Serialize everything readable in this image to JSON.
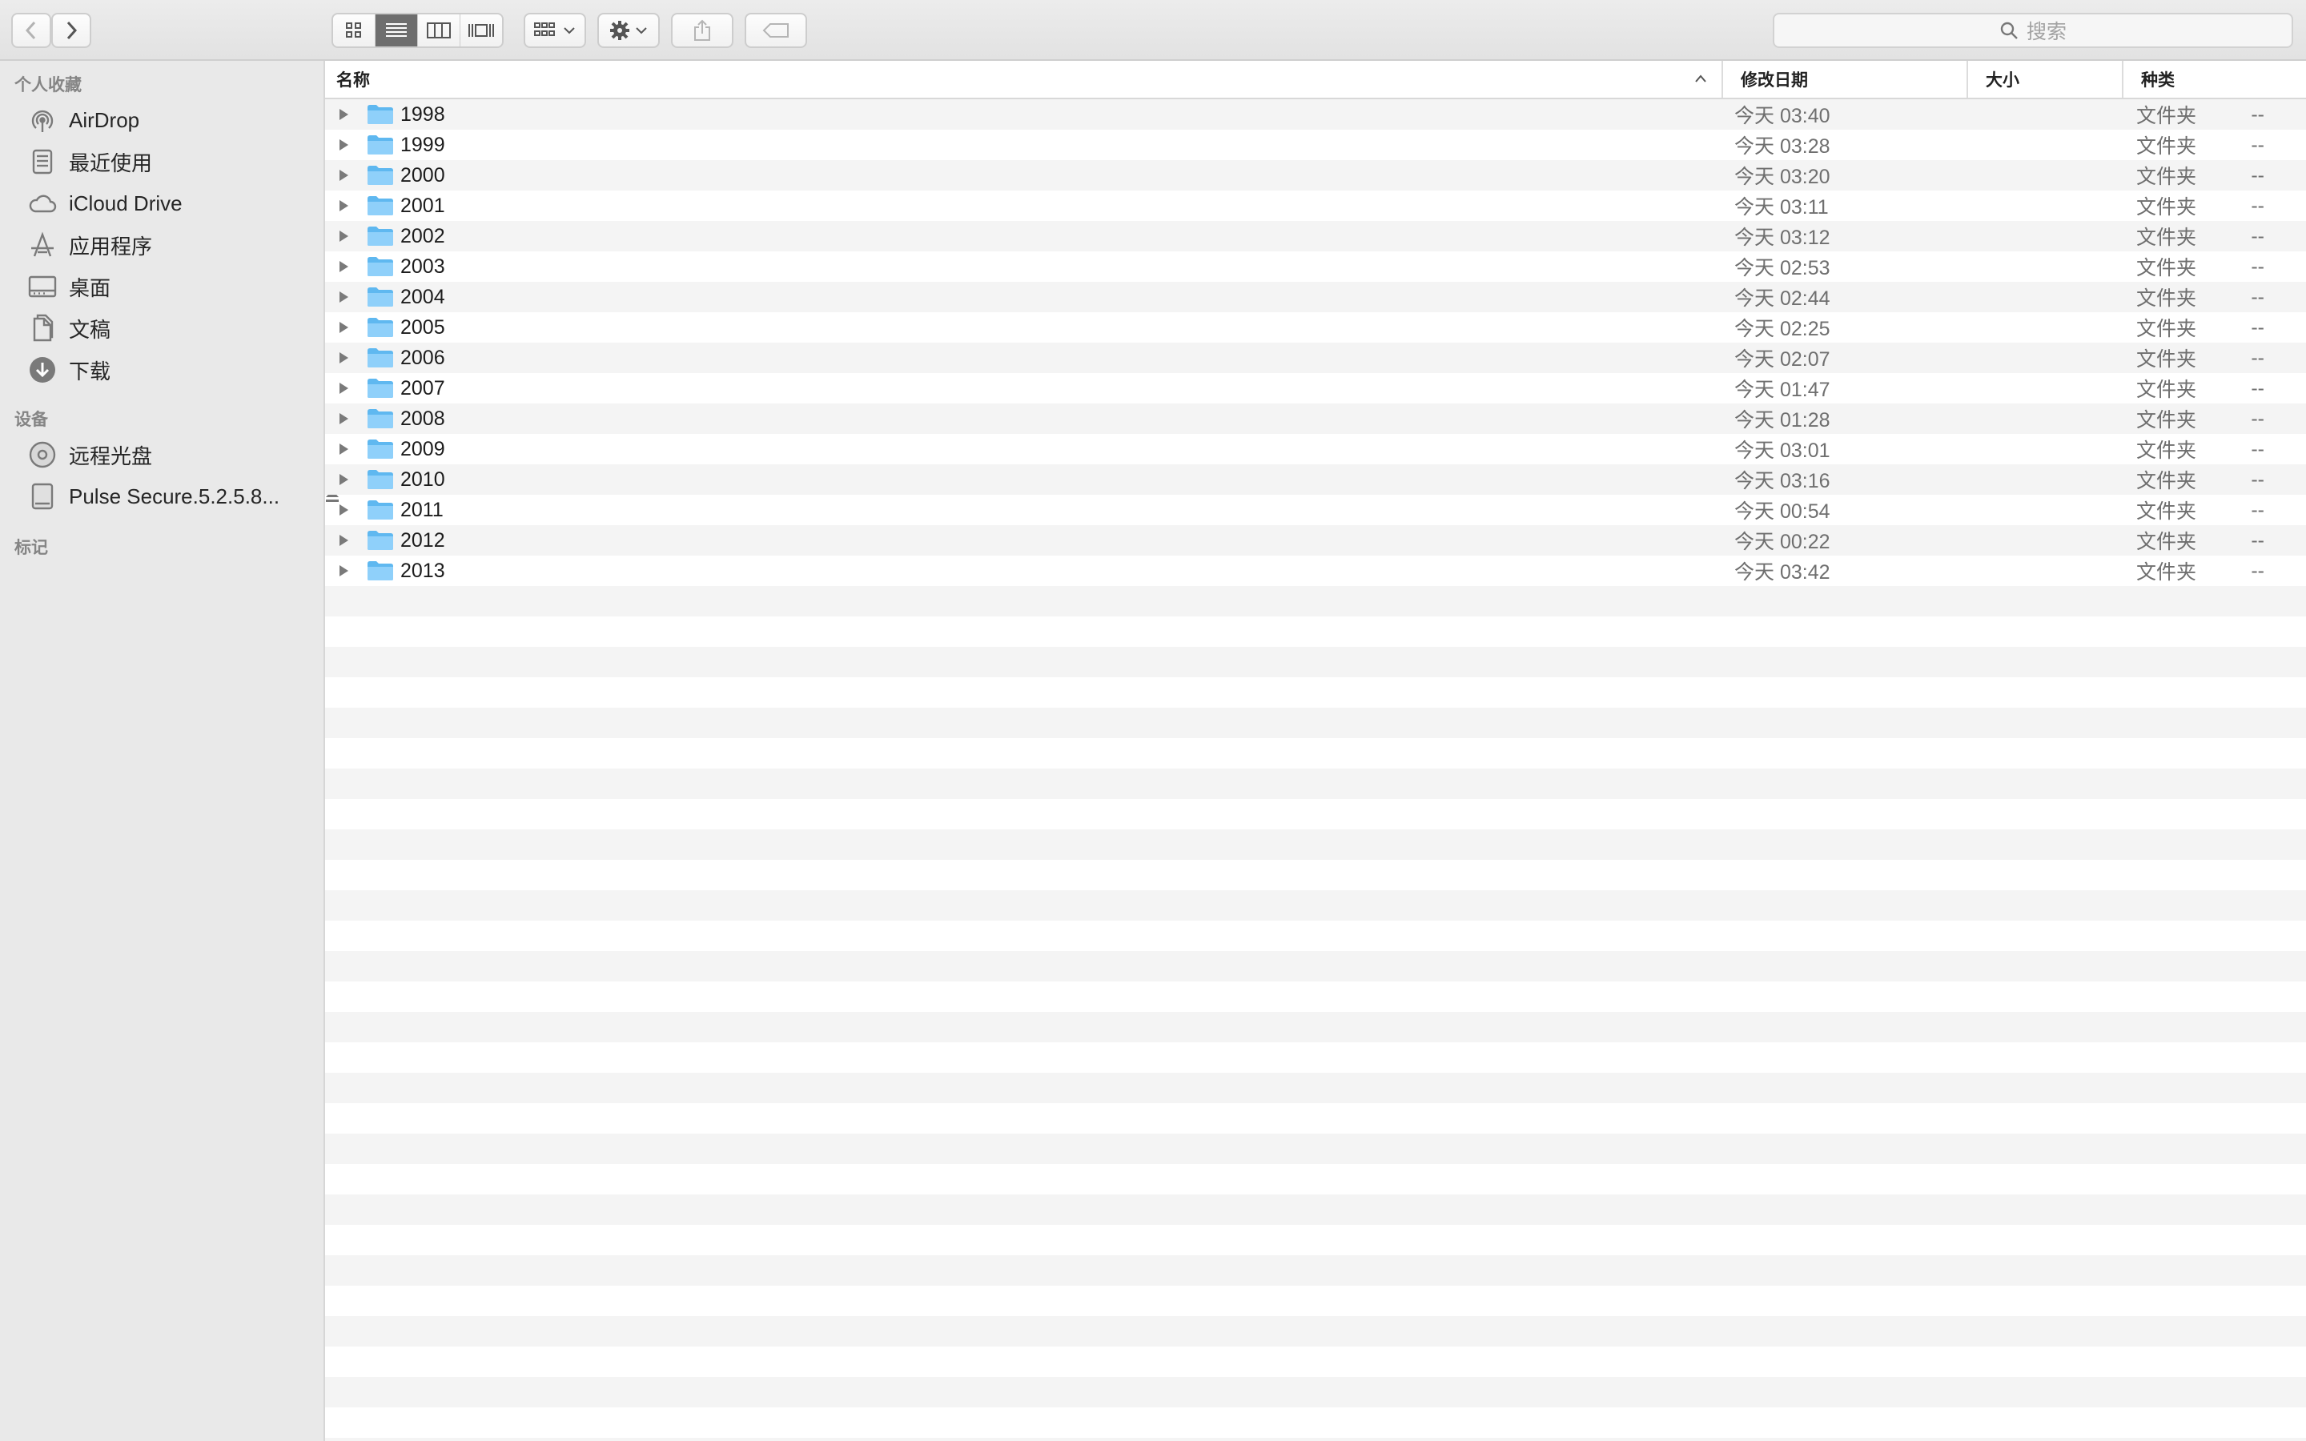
{
  "toolbar": {
    "search_placeholder": "搜索",
    "icons": [
      "chevron-left-icon",
      "chevron-right-icon",
      "icon-view-icon",
      "list-view-icon",
      "column-view-icon",
      "gallery-view-icon",
      "group-icon",
      "gear-icon",
      "share-icon",
      "tag-icon",
      "search-icon"
    ]
  },
  "sidebar": {
    "favorites_title": "个人收藏",
    "favorites": [
      {
        "label": "AirDrop",
        "icon": "airdrop-icon"
      },
      {
        "label": "最近使用",
        "icon": "recents-icon"
      },
      {
        "label": "iCloud Drive",
        "icon": "cloud-icon"
      },
      {
        "label": "应用程序",
        "icon": "applications-icon"
      },
      {
        "label": "桌面",
        "icon": "desktop-icon"
      },
      {
        "label": "文稿",
        "icon": "documents-icon"
      },
      {
        "label": "下载",
        "icon": "downloads-icon"
      }
    ],
    "devices_title": "设备",
    "devices": [
      {
        "label": "远程光盘",
        "icon": "disc-icon"
      },
      {
        "label": "Pulse Secure.5.2.5.8...",
        "icon": "drive-icon"
      }
    ],
    "tags_title": "标记"
  },
  "columns": {
    "name": "名称",
    "date": "修改日期",
    "size": "大小",
    "kind": "种类"
  },
  "files": [
    {
      "name": "1998",
      "date": "今天 03:40",
      "size": "--",
      "kind": "文件夹"
    },
    {
      "name": "1999",
      "date": "今天 03:28",
      "size": "--",
      "kind": "文件夹"
    },
    {
      "name": "2000",
      "date": "今天 03:20",
      "size": "--",
      "kind": "文件夹"
    },
    {
      "name": "2001",
      "date": "今天 03:11",
      "size": "--",
      "kind": "文件夹"
    },
    {
      "name": "2002",
      "date": "今天 03:12",
      "size": "--",
      "kind": "文件夹"
    },
    {
      "name": "2003",
      "date": "今天 02:53",
      "size": "--",
      "kind": "文件夹"
    },
    {
      "name": "2004",
      "date": "今天 02:44",
      "size": "--",
      "kind": "文件夹"
    },
    {
      "name": "2005",
      "date": "今天 02:25",
      "size": "--",
      "kind": "文件夹"
    },
    {
      "name": "2006",
      "date": "今天 02:07",
      "size": "--",
      "kind": "文件夹"
    },
    {
      "name": "2007",
      "date": "今天 01:47",
      "size": "--",
      "kind": "文件夹"
    },
    {
      "name": "2008",
      "date": "今天 01:28",
      "size": "--",
      "kind": "文件夹"
    },
    {
      "name": "2009",
      "date": "今天 03:01",
      "size": "--",
      "kind": "文件夹"
    },
    {
      "name": "2010",
      "date": "今天 03:16",
      "size": "--",
      "kind": "文件夹"
    },
    {
      "name": "2011",
      "date": "今天 00:54",
      "size": "--",
      "kind": "文件夹"
    },
    {
      "name": "2012",
      "date": "今天 00:22",
      "size": "--",
      "kind": "文件夹"
    },
    {
      "name": "2013",
      "date": "今天 03:42",
      "size": "--",
      "kind": "文件夹"
    }
  ],
  "colors": {
    "sidebar_bg": "#e9e9e9",
    "folder": "#6fc2f5",
    "stripe": "#f4f4f4",
    "active_segment": "#6e6e6e"
  }
}
